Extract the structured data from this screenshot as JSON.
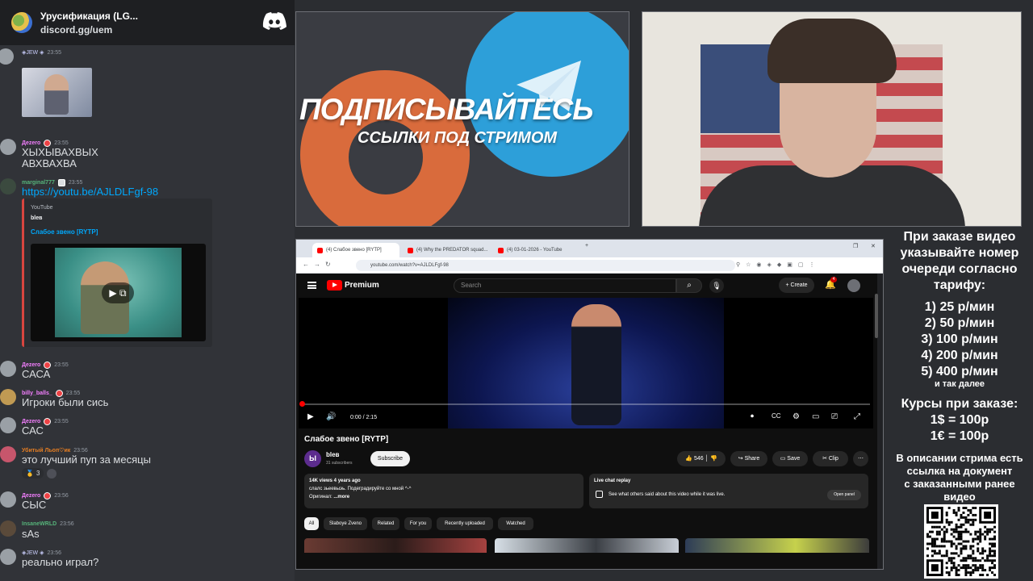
{
  "chat": {
    "server_name": "Урусификация (LG...",
    "server_link": "discord.gg/uem",
    "messages": [
      {
        "user": "",
        "tags": "◈JEW ◈",
        "time": "23:55",
        "text": ""
      },
      {
        "user": "Дezero",
        "time": "23:55",
        "text": "ХЫХЫВАХВЫХ\nАВХВАХВА"
      },
      {
        "user": "marginal777",
        "time": "23:55",
        "text": "https://youtu.be/AJLDLFgf-98"
      },
      {
        "user": "Дezero",
        "time": "23:55",
        "text": "САСА"
      },
      {
        "user": "billy_balls_",
        "time": "23:55",
        "text": "Игроки были сись"
      },
      {
        "user": "Дezero",
        "time": "23:55",
        "text": "САС"
      },
      {
        "user": "Убитый Льоп♡ик",
        "time": "23:56",
        "text": "это лучший пуп за месяцы"
      },
      {
        "user": "Дezero",
        "time": "23:56",
        "text": "СЫС"
      },
      {
        "user": "InsaneWRLD",
        "time": "23:56",
        "text": "sAs"
      },
      {
        "user": "",
        "tags": "◈JEW ◈",
        "time": "23:56",
        "text": "реально играл?"
      }
    ],
    "embed": {
      "provider": "YouTube",
      "author": "bleв",
      "title": "Слабое звено [RYTP]"
    },
    "reaction": {
      "emoji": "medal-icon",
      "count": "3"
    }
  },
  "promo": {
    "headline": "ПОДПИСЫВАЙТЕСЬ",
    "subline": "ССЫЛКИ ПОД СТРИМОМ",
    "colors": {
      "boosty": "#d96b3c",
      "telegram": "#2d9fd9"
    }
  },
  "browser": {
    "tabs": [
      "(4) Слабое звено [RYTP]",
      "(4) Why the PREDATOR squad...",
      "(4) 03-01-2026 - YouTube"
    ],
    "url": "youtube.com/watch?v=AJLDLFgf-98"
  },
  "youtube": {
    "brand": "Premium",
    "search_placeholder": "Search",
    "create_label": "Create",
    "notif_count": "4",
    "player": {
      "time": "0:00 / 2:15",
      "progress": 0.0
    },
    "video": {
      "title": "Слабое звено [RYTP]",
      "channel_initial": "Ы",
      "channel": "bleв",
      "subscribers": "31 subscribers",
      "subscribe_label": "Subscribe",
      "likes": "546",
      "share_label": "Share",
      "save_label": "Save",
      "clip_label": "Clip",
      "views_date": "14K views  4 years ago",
      "desc_line1": "слалс зьеевыэь. Подеградируйте со мной ^-^",
      "desc_line2": "Оригинал:",
      "more_label": "...more"
    },
    "replay": {
      "title": "Live chat replay",
      "text": "See what others said about this video while it was live.",
      "button": "Open panel"
    },
    "chips": [
      "All",
      "Slaboye Zveno",
      "Related",
      "For you",
      "Recently uploaded",
      "Watched"
    ]
  },
  "info": {
    "instructions": "При заказе видео\nуказывайте номер\nочереди согласно\nтарифу:",
    "tariffs": "1) 25 р/мин\n2) 50 р/мин\n3) 100 р/мин\n4) 200 р/мин\n5) 400 р/мин",
    "etc": "и так далее",
    "rates": "Курсы при заказе:\n1$ = 100р\n1€ = 100р",
    "note": "В описании стрима есть\nссылка на документ\nс заказанными ранее\nвидео"
  }
}
